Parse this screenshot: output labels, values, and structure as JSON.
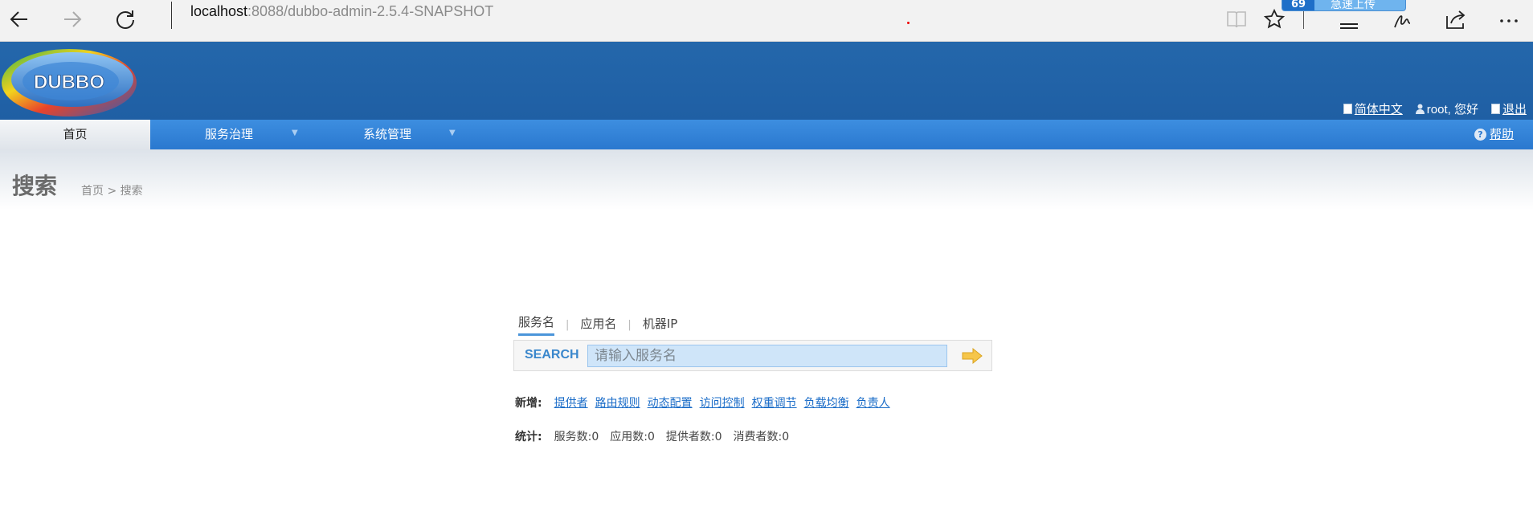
{
  "browser": {
    "url_host": "localhost",
    "url_rest": ":8088/dubbo-admin-2.5.4-SNAPSHOT",
    "ext_logo": "69",
    "ext_label": "急速上传"
  },
  "header": {
    "logo_text": "DUBBO",
    "language_link": "简体中文",
    "user_greeting": "root, 您好",
    "logout_link": "退出"
  },
  "nav": {
    "items": [
      {
        "label": "首页"
      },
      {
        "label": "服务治理"
      },
      {
        "label": "系统管理"
      }
    ],
    "help": "帮助"
  },
  "page": {
    "title": "搜索",
    "breadcrumb": "首页 > 搜索"
  },
  "search": {
    "tabs": [
      {
        "label": "服务名"
      },
      {
        "label": "应用名"
      },
      {
        "label": "机器IP"
      }
    ],
    "label": "SEARCH",
    "placeholder": "请输入服务名"
  },
  "add_new": {
    "label": "新增:",
    "links": [
      "提供者",
      "路由规则",
      "动态配置",
      "访问控制",
      "权重调节",
      "负载均衡",
      "负责人"
    ]
  },
  "stats": {
    "label": "统计:",
    "items": [
      "服务数:0",
      "应用数:0",
      "提供者数:0",
      "消费者数:0"
    ]
  },
  "colors": {
    "header_blue": "#2467ab",
    "nav_blue": "#2a78cf",
    "link_blue": "#1a6cc8"
  }
}
